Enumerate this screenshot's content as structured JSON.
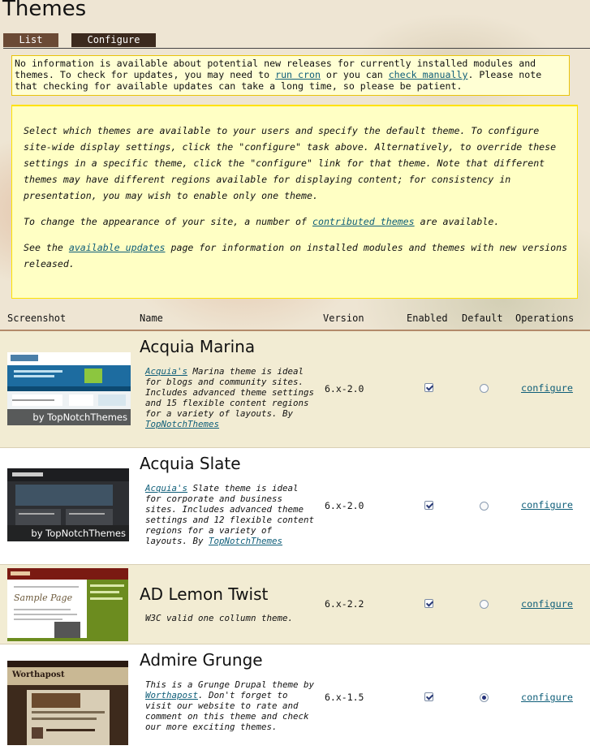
{
  "page": {
    "title": "Themes"
  },
  "tabs": [
    {
      "label": "List"
    },
    {
      "label": "Configure"
    }
  ],
  "notice": {
    "text_1": "No information is available about potential new releases for currently installed modules and themes. To check for updates, you may need to ",
    "link_run_cron": "run cron",
    "text_2": " or you can ",
    "link_check_manually": "check manually",
    "text_3": ". Please note that checking for available updates can take a long time, so please be patient."
  },
  "help": {
    "p1": "Select which themes are available to your users and specify the default theme. To configure site-wide display settings, click the \"configure\" task above. Alternatively, to override these settings in a specific theme, click the \"configure\" link for that theme. Note that different themes may have different regions available for displaying content; for consistency in presentation, you may wish to enable only one theme.",
    "p2_before": "To change the appearance of your site, a number of ",
    "p2_link": "contributed themes",
    "p2_after": " are available.",
    "p3_before": "See the ",
    "p3_link": "available updates",
    "p3_after": " page for information on installed modules and themes with new versions released."
  },
  "table": {
    "headers": {
      "screenshot": "Screenshot",
      "name": "Name",
      "version": "Version",
      "enabled": "Enabled",
      "default": "Default",
      "operations": "Operations"
    },
    "rows": [
      {
        "name": "Acquia Marina",
        "desc_link": "Acquia's",
        "desc_text": " Marina theme is ideal for blogs and community sites. Includes advanced theme settings and 15 flexible content regions for a variety of layouts. By ",
        "desc_link2": "TopNotchThemes",
        "version": "6.x-2.0",
        "enabled": true,
        "default": false,
        "op": "configure",
        "shot_badge": "by TopNotchThemes"
      },
      {
        "name": "Acquia Slate",
        "desc_link": "Acquia's",
        "desc_text": " Slate theme is ideal for corporate and business sites. Includes advanced theme settings and 12 flexible content regions for a variety of layouts. By ",
        "desc_link2": "TopNotchThemes",
        "version": "6.x-2.0",
        "enabled": true,
        "default": false,
        "op": "configure",
        "shot_badge": "by TopNotchThemes"
      },
      {
        "name": "AD Lemon Twist",
        "desc_text": "W3C valid one collumn theme.",
        "version": "6.x-2.2",
        "enabled": true,
        "default": false,
        "op": "configure",
        "shot_text": "Sample Page"
      },
      {
        "name": "Admire Grunge",
        "desc_before": "This is a Grunge Drupal theme by ",
        "desc_link": "Worthapost",
        "desc_after": ". Don't forget to visit our website to rate and comment on this theme and check our more exciting themes.",
        "version": "6.x-1.5",
        "enabled": true,
        "default": true,
        "op": "configure",
        "shot_text": "Worthapost"
      }
    ]
  },
  "colors": {
    "link": "#0f5e79",
    "tab_active": "#3c2a1e",
    "tab_inactive": "#6b4a35",
    "notice_bg": "#ffffd4",
    "help_bg": "#ffffc4",
    "row_odd": "#f2ecd3"
  }
}
